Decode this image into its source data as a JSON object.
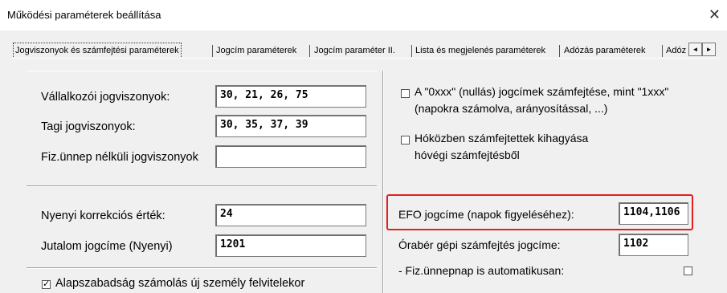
{
  "window": {
    "title": "Működési paraméterek beállítása",
    "close_glyph": "✕"
  },
  "tabs": [
    "Jogviszonyok és számfejtési paraméterek",
    "Jogcím paraméterek",
    "Jogcím paraméter II.",
    "Lista és megjelenés paraméterek",
    "Adózás paraméterek",
    "Adóz"
  ],
  "tab_scroll": {
    "left": "◄",
    "right": "►"
  },
  "left": {
    "vallalkozoi": {
      "label": "Vállalkozói jogviszonyok:",
      "value": "30, 21, 26, 75"
    },
    "tagi": {
      "label": "Tagi jogviszonyok:",
      "value": "30, 35, 37, 39"
    },
    "fizunnep": {
      "label": "Fiz.ünnep nélküli jogviszonyok",
      "value": ""
    },
    "nyenyi_korr": {
      "label": "Nyenyi korrekciós érték:",
      "value": "24"
    },
    "jutalom": {
      "label": "Jutalom jogcíme (Nyenyi)",
      "value": "1201"
    },
    "alapszab": {
      "label": "Alapszabadság számolás új személy felvitelekor",
      "checked": true
    }
  },
  "right": {
    "nullas": {
      "label_line1": "A \"0xxx\" (nullás) jogcímek számfejtése, mint \"1xxx\"",
      "label_line2": "(napokra számolva, arányosítással, ...)",
      "checked": false
    },
    "hokozben": {
      "label_line1": "Hóközben számfejtettek kihagyása",
      "label_line2": "hóvégi számfejtésből",
      "checked": false
    },
    "efo": {
      "label": "EFO jogcíme (napok figyeléséhez):",
      "value": "1104,1106"
    },
    "oraber": {
      "label": "Órabér gépi számfejtés jogcíme:",
      "value": "1102"
    },
    "fizunnep_auto": {
      "label": "- Fiz.ünnepnap is automatikusan:",
      "checked": false
    }
  },
  "colors": {
    "highlight": "#e02020",
    "background": "#f0f0f0"
  }
}
